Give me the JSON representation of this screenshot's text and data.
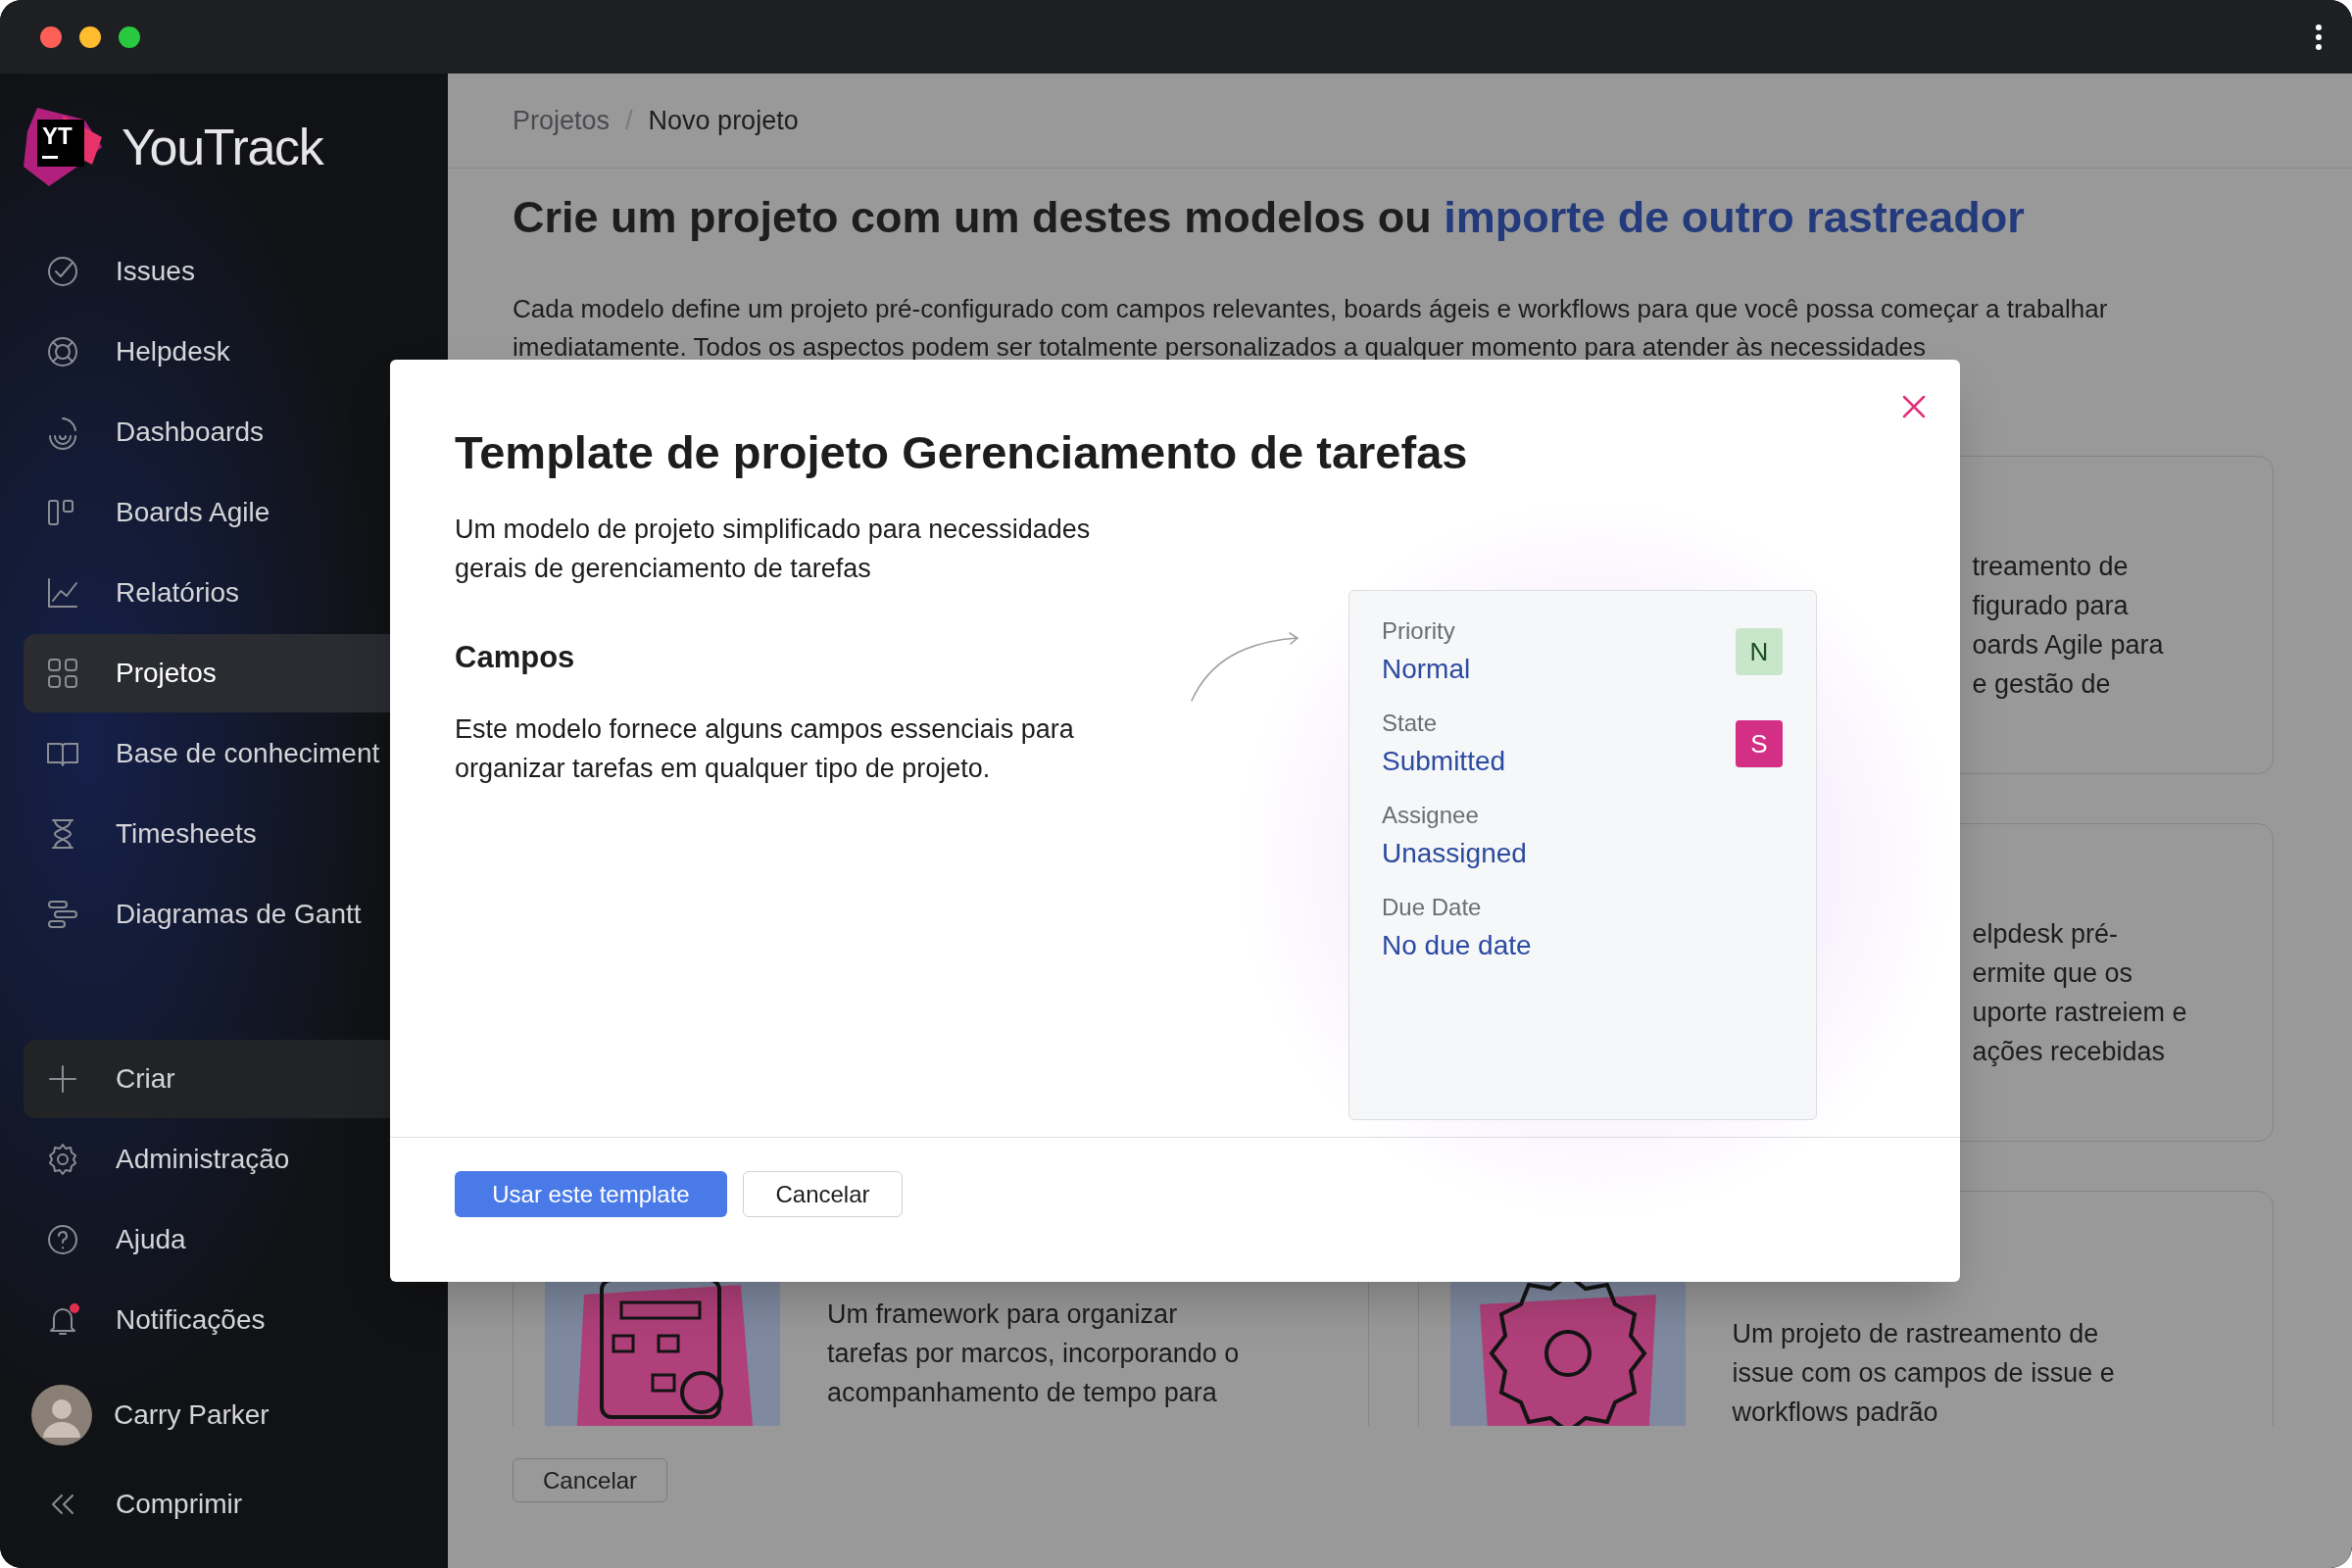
{
  "app": {
    "logo": "YT",
    "name": "YouTrack"
  },
  "sidebar": {
    "items": [
      {
        "label": "Issues",
        "selected": false
      },
      {
        "label": "Helpdesk",
        "selected": false
      },
      {
        "label": "Dashboards",
        "selected": false
      },
      {
        "label": "Boards Agile",
        "selected": false
      },
      {
        "label": "Relatórios",
        "selected": false
      },
      {
        "label": "Projetos",
        "selected": true
      },
      {
        "label": "Base de conheciment",
        "selected": false
      },
      {
        "label": "Timesheets",
        "selected": false
      },
      {
        "label": "Diagramas de Gantt",
        "selected": false
      }
    ],
    "create": {
      "label": "Criar"
    },
    "bottom_items": [
      {
        "label": "Administração",
        "alert": false
      },
      {
        "label": "Ajuda",
        "alert": false
      },
      {
        "label": "Notificações",
        "alert": true
      }
    ],
    "user": {
      "name": "Carry Parker"
    },
    "collapse": {
      "label": "Comprimir"
    }
  },
  "breadcrumbs": [
    {
      "label": "Projetos",
      "current": false
    },
    {
      "label": "Novo projeto",
      "current": true
    }
  ],
  "breadcrumb_separator": "/",
  "heading": {
    "text": "Crie um projeto com um destes modelos ou ",
    "link": "importe de outro rastreador"
  },
  "intro": "Cada modelo define um projeto pré-configurado com campos relevantes, boards ágeis e workflows para que você possa começar a trabalhar imediatamente. Todos os aspectos podem ser totalmente personalizados a qualquer momento para atender às necessidades",
  "template_cards": [
    {
      "lines": [
        "treamento de",
        "figurado para",
        "oards Agile para",
        "e gestão de"
      ]
    },
    {
      "lines": [
        "elpdesk pré-",
        "ermite que os",
        "uporte rastreiem e",
        "ações recebidas"
      ]
    }
  ],
  "bottom_cards": [
    {
      "kind": "workflow",
      "lines": [
        "Um framework para organizar",
        "tarefas por marcos, incorporando o",
        "acompanhamento de tempo para"
      ]
    },
    {
      "kind": "gear",
      "lines": [
        "Um projeto de rastreamento de",
        "issue com os campos de issue e",
        "workflows padrão"
      ]
    }
  ],
  "page_cancel": "Cancelar",
  "modal": {
    "title": "Template de projeto Gerenciamento de tarefas",
    "description": "Um modelo de projeto simplificado para necessidades gerais de gerenciamento de tarefas",
    "section_title": "Campos",
    "section_text": "Este modelo fornece alguns campos essenciais para organizar tarefas em qualquer tipo de projeto.",
    "fields": [
      {
        "label": "Priority",
        "value": "Normal",
        "badge": "N",
        "color": "#c8e6c9"
      },
      {
        "label": "State",
        "value": "Submitted",
        "badge": "S",
        "color": "#d32f85"
      },
      {
        "label": "Assignee",
        "value": "Unassigned"
      },
      {
        "label": "Due Date",
        "value": "No due date"
      }
    ],
    "primary_button": "Usar este template",
    "cancel_button": "Cancelar"
  }
}
